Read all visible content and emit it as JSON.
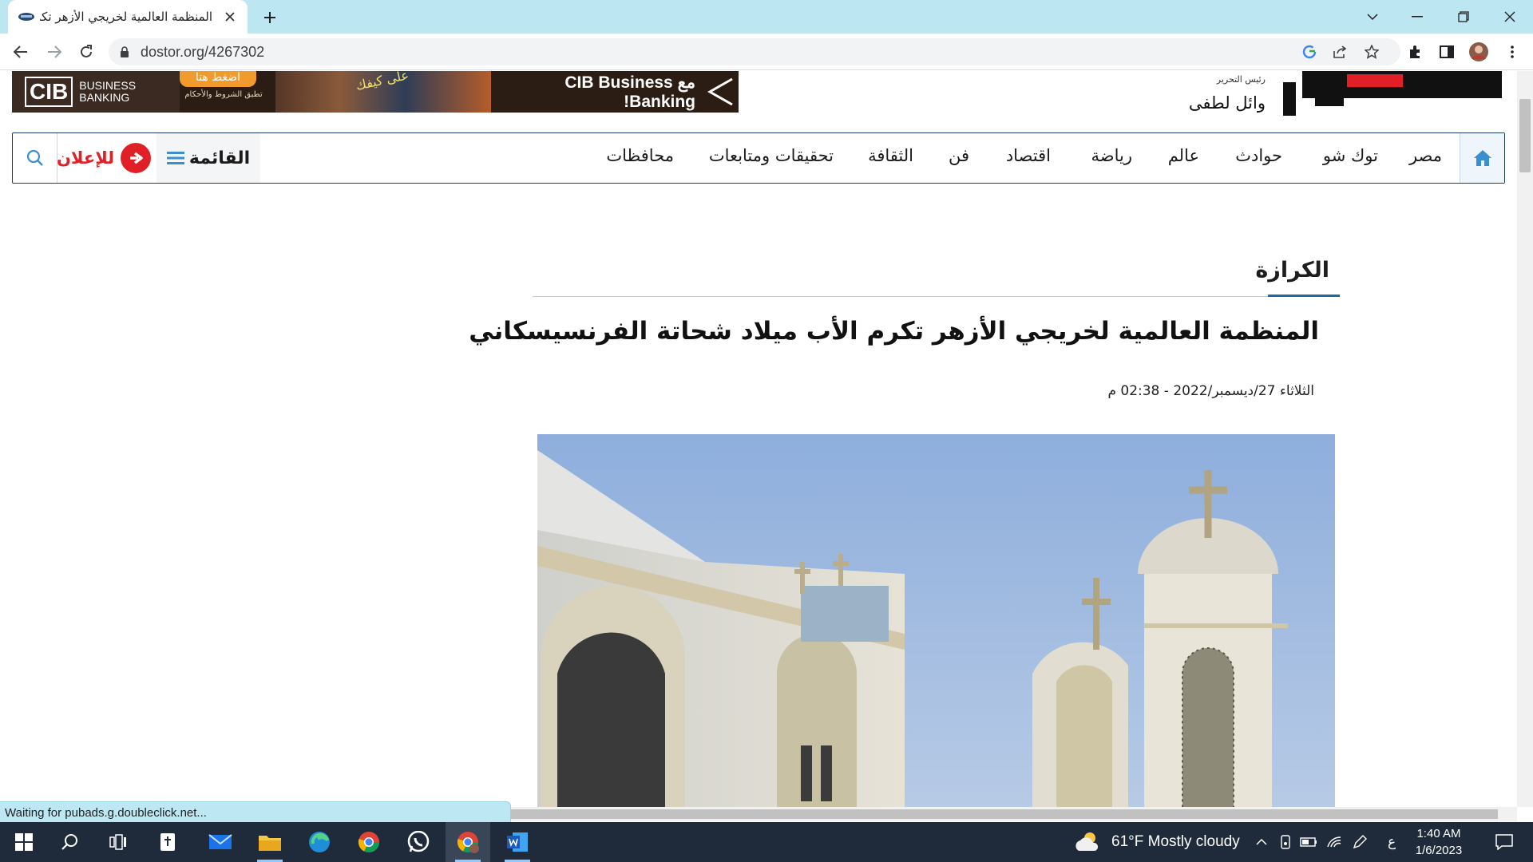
{
  "browser": {
    "tab_title": "المنظمة العالمية لخريجي الأزهر تكرم الأب ميلاد شحاتة الفرنسيسكاني",
    "url": "dostor.org/4267302",
    "status_text": "Waiting for pubads.g.doubleclick.net..."
  },
  "header": {
    "ad": {
      "brand": "CIB",
      "brand_subtitle_1": "BUSINESS",
      "brand_subtitle_2": "BANKING",
      "press_here": "اضغط هنا",
      "terms": "تطبق الشروط والأحكام",
      "photo_text": "على كيفك",
      "headline": "مع CIB Business Banking!"
    },
    "editor_label": "رئيس التحرير",
    "editor_name": "وائل لطفى"
  },
  "nav": {
    "items": [
      "مصر",
      "توك شو",
      "حوادث",
      "عالم",
      "رياضة",
      "اقتصاد",
      "فن",
      "الثقافة",
      "تحقيقات ومتابعات",
      "محافظات"
    ],
    "menu_label": "القائمة",
    "ads_label": "للإعلان"
  },
  "article": {
    "section": "الكرازة",
    "headline": "المنظمة العالمية لخريجي الأزهر تكرم الأب ميلاد شحاتة الفرنسيسكاني",
    "date": "الثلاثاء 27/ديسمبر/2022 - 02:38 م"
  },
  "taskbar": {
    "weather": "61°F  Mostly cloudy",
    "lang": "ع",
    "time": "1:40 AM",
    "date": "1/6/2023"
  },
  "colors": {
    "tab_strip": "#bce6f1",
    "nav_border": "#1c3c5f",
    "ads_red": "#e02026",
    "section_accent": "#1c6aa7",
    "taskbar": "#1f2b3a"
  }
}
